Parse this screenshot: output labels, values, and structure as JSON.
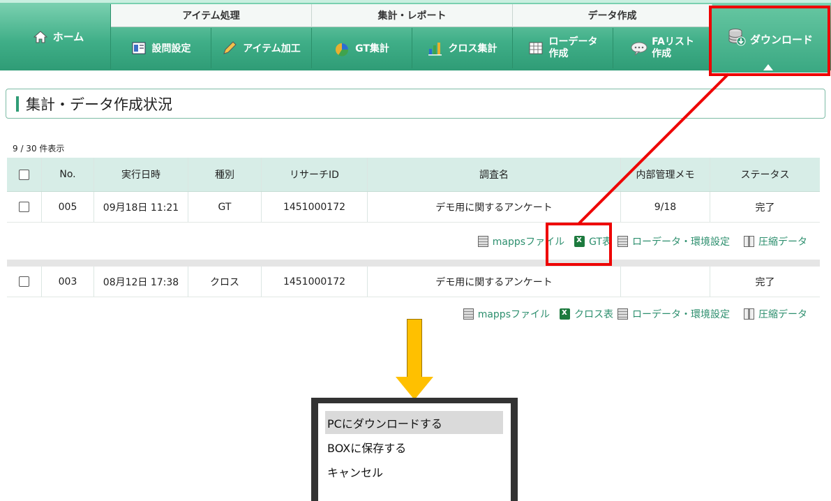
{
  "nav": {
    "home_label": "ホーム",
    "groups": [
      {
        "label": "アイテム処理"
      },
      {
        "label": "集計・レポート"
      },
      {
        "label": "データ作成"
      }
    ],
    "buttons": [
      {
        "label": "設問設定",
        "icon": "settings-sheet-icon"
      },
      {
        "label": "アイテム加工",
        "icon": "pencil-icon"
      },
      {
        "label": "GT集計",
        "icon": "pie-chart-icon"
      },
      {
        "label": "クロス集計",
        "icon": "bar-chart-icon"
      },
      {
        "line1": "ローデータ",
        "line2": "作成",
        "icon": "raw-data-icon"
      },
      {
        "line1": "FAリスト",
        "line2": "作成",
        "icon": "speech-bubble-icon"
      }
    ],
    "download_label": "ダウンロード",
    "accent": "#3fae87",
    "highlight_color": "#e00000"
  },
  "page": {
    "heading": "集計・データ作成状況",
    "count_text": "9 / 30 件表示"
  },
  "table": {
    "headers": [
      "No.",
      "実行日時",
      "種別",
      "リサーチID",
      "調査名",
      "内部管理メモ",
      "ステータス"
    ],
    "rows": [
      {
        "no": "005",
        "datetime": "09月18日 11:21",
        "type": "GT",
        "research_id": "1451000172",
        "survey": "デモ用に関するアンケート",
        "memo": "9/18",
        "status": "完了",
        "links": {
          "mapps": "mappsファイル",
          "table": "GT表",
          "raw": "ローデータ・環境設定",
          "zip": "圧縮データ"
        }
      },
      {
        "no": "003",
        "datetime": "08月12日 17:38",
        "type": "クロス",
        "research_id": "1451000172",
        "survey": "デモ用に関するアンケート",
        "memo": "",
        "status": "完了",
        "links": {
          "mapps": "mappsファイル",
          "table": "クロス表",
          "raw": "ローデータ・環境設定",
          "zip": "圧縮データ"
        }
      }
    ]
  },
  "menu": {
    "items": [
      "PCにダウンロードする",
      "BOXに保存する",
      "キャンセル"
    ]
  }
}
